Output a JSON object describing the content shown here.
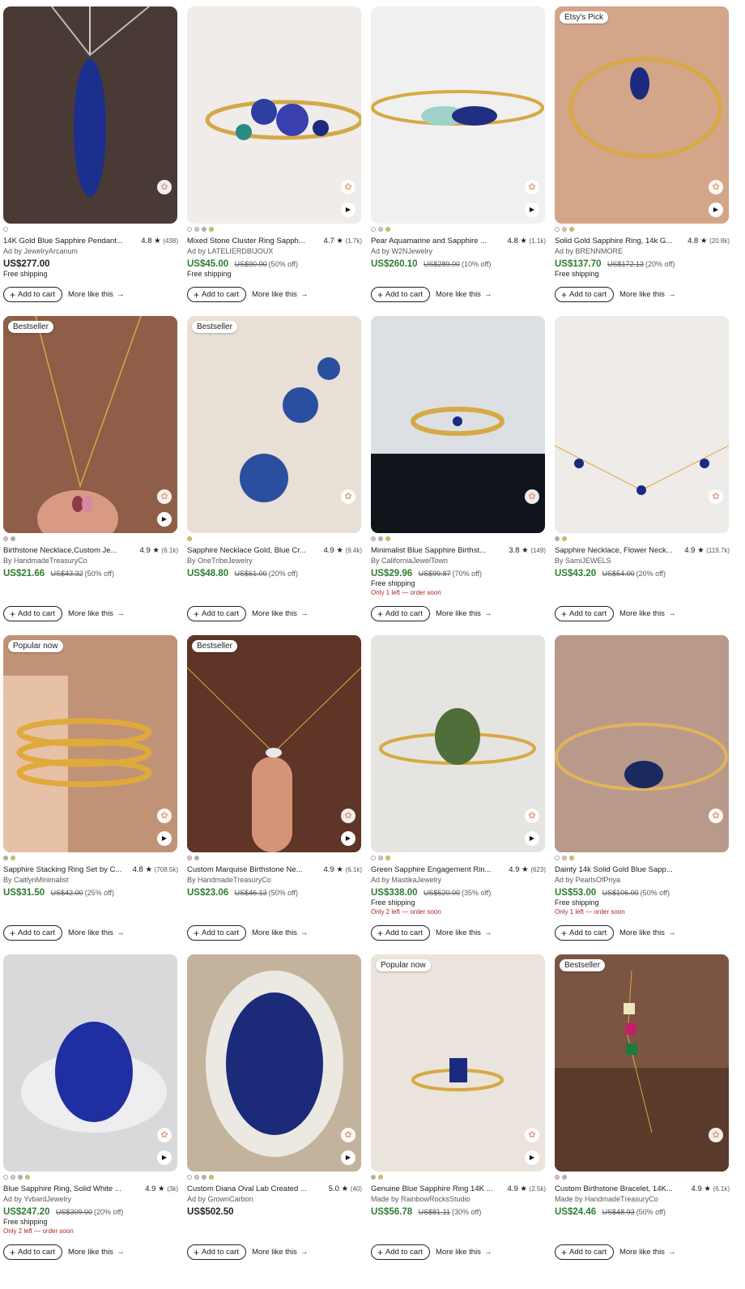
{
  "common": {
    "add_to_cart": "Add to cart",
    "more_like_this": "More like this",
    "arrow": "→",
    "plus": "+",
    "star": "★",
    "play": "▶",
    "favorite_icon": "✿"
  },
  "listings": [
    {
      "badge": "",
      "dots": [
        "#ffffff"
      ],
      "title": "14K Gold Blue Sapphire Pendant...",
      "rating": "4.8",
      "count": "(438)",
      "shop": "Ad by JewelryArcanum",
      "price": "US$277.00",
      "orig": "",
      "pct": "",
      "ship": "Free shipping",
      "left": "",
      "video": false,
      "bg": "#4a3a36"
    },
    {
      "badge": "",
      "dots": [
        "#ffffff",
        "#f4b6c2",
        "#b0b0b0",
        "#e6c229"
      ],
      "title": "Mixed Stone Cluster Ring Sapph...",
      "rating": "4.7",
      "count": "(1.7k)",
      "shop": "Ad by LATELIERDBIJOUX",
      "price": "US$45.00",
      "orig": "US$90.00",
      "pct": "(50% off)",
      "ship": "Free shipping",
      "left": "",
      "video": true,
      "bg": "#e9e6e2"
    },
    {
      "badge": "",
      "dots": [
        "#ffffff",
        "#f4b6c2",
        "#e6c229"
      ],
      "title": "Pear Aquamarine and Sapphire ...",
      "rating": "4.8",
      "count": "(1.1k)",
      "shop": "Ad by W2NJewelry",
      "price": "US$260.10",
      "orig": "US$289.00",
      "pct": "(10% off)",
      "ship": "",
      "left": "",
      "video": true,
      "bg": "#eeeeee"
    },
    {
      "badge": "Etsy's Pick",
      "dots": [
        "#ffffff",
        "#f4b6c2",
        "#e6c229"
      ],
      "title": "Solid Gold Sapphire Ring, 14k G...",
      "rating": "4.8",
      "count": "(20.8k)",
      "shop": "Ad by BRENNMORE",
      "price": "US$137.70",
      "orig": "US$172.13",
      "pct": "(20% off)",
      "ship": "Free shipping",
      "left": "",
      "video": true,
      "bg": "#c99a7f"
    },
    {
      "badge": "Bestseller",
      "dots": [
        "#f4b6c2",
        "#b0b0b0"
      ],
      "title": "Birthstone Necklace,Custom Je...",
      "rating": "4.9",
      "count": "(6.1k)",
      "shop": "By HandmadeTreasuryCo",
      "price": "US$21.66",
      "orig": "US$43.32",
      "pct": "(50% off)",
      "ship": "",
      "left": "",
      "video": true,
      "bg": "#8a5a44"
    },
    {
      "badge": "Bestseller",
      "dots": [
        "#e6c229"
      ],
      "title": "Sapphire Necklace Gold, Blue Cr...",
      "rating": "4.9",
      "count": "(9.4k)",
      "shop": "By OneTribeJewelry",
      "price": "US$48.80",
      "orig": "US$61.00",
      "pct": "(20% off)",
      "ship": "",
      "left": "",
      "video": false,
      "bg": "#e7dfd6"
    },
    {
      "badge": "",
      "dots": [
        "#f4b6c2",
        "#b0b0b0",
        "#e6c229"
      ],
      "title": "Minimalist Blue Sapphire Birthst...",
      "rating": "3.8",
      "count": "(149)",
      "shop": "By CaliforniaJewelTown",
      "price": "US$29.96",
      "orig": "US$99.87",
      "pct": "(70% off)",
      "ship": "Free shipping",
      "left": "Only 1 left — order soon",
      "video": false,
      "bg": "#d9dcdf"
    },
    {
      "badge": "",
      "dots": [
        "#b0b0b0",
        "#e6c229"
      ],
      "title": "Sapphire Necklace, Flower Neck...",
      "rating": "4.9",
      "count": "(119.7k)",
      "shop": "By SamiJEWELS",
      "price": "US$43.20",
      "orig": "US$54.00",
      "pct": "(20% off)",
      "ship": "",
      "left": "",
      "video": false,
      "bg": "#eceae8"
    },
    {
      "badge": "Popular now",
      "dots": [
        "#b0b0b0",
        "#e6c229"
      ],
      "title": "Sapphire Stacking Ring Set by C...",
      "rating": "4.8",
      "count": "(708.5k)",
      "shop": "By CaitlynMinimalist",
      "price": "US$31.50",
      "orig": "US$42.00",
      "pct": "(25% off)",
      "ship": "",
      "left": "",
      "video": true,
      "bg": "#b98d74"
    },
    {
      "badge": "Bestseller",
      "dots": [
        "#f4b6c2",
        "#b0b0b0"
      ],
      "title": "Custom Marquise Birthstone Ne...",
      "rating": "4.9",
      "count": "(6.1k)",
      "shop": "By HandmadeTreasuryCo",
      "price": "US$23.06",
      "orig": "US$46.13",
      "pct": "(50% off)",
      "ship": "",
      "left": "",
      "video": true,
      "bg": "#6a3a2a"
    },
    {
      "badge": "",
      "dots": [
        "#ffffff",
        "#f4b6c2",
        "#e6c229"
      ],
      "title": "Green Sapphire Engagement Rin...",
      "rating": "4.9",
      "count": "(623)",
      "shop": "Ad by MastikaJewelry",
      "price": "US$338.00",
      "orig": "US$520.00",
      "pct": "(35% off)",
      "ship": "Free shipping",
      "left": "Only 2 left — order soon",
      "video": true,
      "bg": "#e4e2de"
    },
    {
      "badge": "",
      "dots": [
        "#ffffff",
        "#f4b6c2",
        "#e6c229"
      ],
      "title": "Dainty 14k Solid Gold Blue Sapp...",
      "rating": "",
      "count": "",
      "shop": "Ad by PearlsOfPriya",
      "price": "US$53.00",
      "orig": "US$106.00",
      "pct": "(50% off)",
      "ship": "Free shipping",
      "left": "Only 1 left — order soon",
      "video": false,
      "bg": "#b89a88"
    },
    {
      "badge": "",
      "dots": [
        "#ffffff",
        "#f4b6c2",
        "#b0b0b0",
        "#e6c229"
      ],
      "title": "Blue Sapphire Ring, Solid White ...",
      "rating": "4.9",
      "count": "(3k)",
      "shop": "Ad by YvbardJewelry",
      "price": "US$247.20",
      "orig": "US$309.00",
      "pct": "(20% off)",
      "ship": "Free shipping",
      "left": "Only 2 left — order soon",
      "video": true,
      "bg": "#d7d7da"
    },
    {
      "badge": "",
      "dots": [
        "#ffffff",
        "#f4b6c2",
        "#b0b0b0",
        "#e6c229"
      ],
      "title": "Custom Diana Oval Lab Created ...",
      "rating": "5.0",
      "count": "(40)",
      "shop": "Ad by GrownCarbon",
      "price": "US$502.50",
      "orig": "",
      "pct": "",
      "ship": "",
      "left": "",
      "video": true,
      "bg": "#c8b7a0"
    },
    {
      "badge": "Popular now",
      "dots": [
        "#b0b0b0",
        "#e6c229"
      ],
      "title": "Genuine Blue Sapphire Ring 14K ...",
      "rating": "4.9",
      "count": "(2.5k)",
      "shop": "Made by RainbowRocksStudio",
      "price": "US$56.78",
      "orig": "US$81.11",
      "pct": "(30% off)",
      "ship": "",
      "left": "",
      "video": true,
      "bg": "#e9e2da"
    },
    {
      "badge": "Bestseller",
      "dots": [
        "#f4b6c2",
        "#b0b0b0"
      ],
      "title": "Custom Birthstone Bracelet, 14K...",
      "rating": "4.9",
      "count": "(6.1k)",
      "shop": "Made by HandmadeTreasuryCo",
      "price": "US$24.46",
      "orig": "US$48.93",
      "pct": "(50% off)",
      "ship": "",
      "left": "",
      "video": false,
      "bg": "#7a5440"
    }
  ]
}
